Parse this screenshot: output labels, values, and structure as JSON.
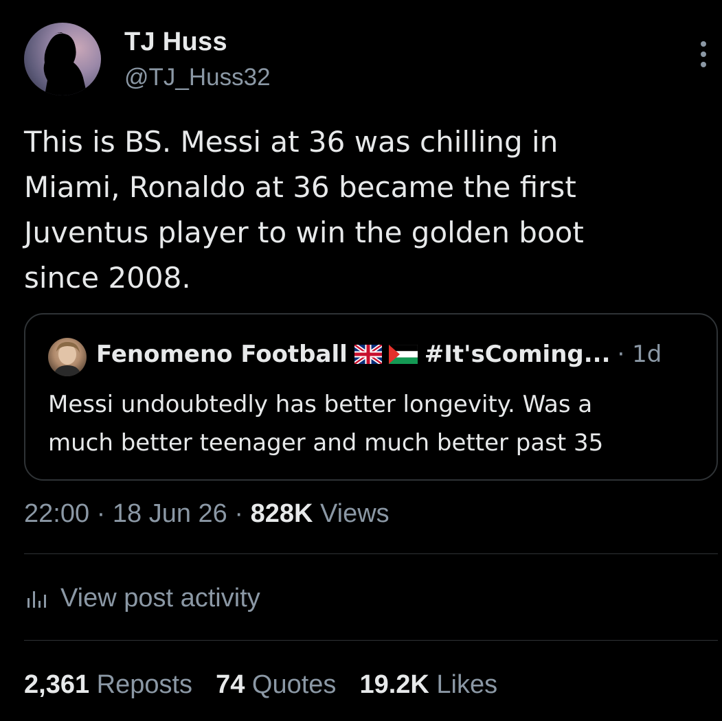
{
  "user": {
    "name": "TJ Huss",
    "handle": "@TJ_Huss32"
  },
  "tweet": {
    "text": "This is BS. Messi at 36 was chilling in\nMiami, Ronaldo at 36 became the first\nJuventus player to win the golden boot\nsince 2008."
  },
  "quote": {
    "author": "Fenomeno Football",
    "flags": [
      "uk-flag-icon",
      "palestine-flag-icon"
    ],
    "hashtag": "#It'sComing...",
    "time": "· 1d",
    "text": "Messi undoubtedly has better longevity. Was a\nmuch better teenager and much better past 35"
  },
  "meta": {
    "time": "22:00",
    "sep1": " · ",
    "date": "18 Jun 26",
    "sep2": " · ",
    "views_count": "828K",
    "views_label": " Views"
  },
  "activity": {
    "icon": "bar-chart-icon",
    "label": "View post activity"
  },
  "stats": {
    "reposts_count": "2,361",
    "reposts_label": "Reposts",
    "quotes_count": "74",
    "quotes_label": "Quotes",
    "likes_count": "19.2K",
    "likes_label": "Likes"
  },
  "colors": {
    "background": "#000000",
    "text_primary": "#e7e9ea",
    "text_secondary": "#8b98a5",
    "border": "#2f3336"
  }
}
